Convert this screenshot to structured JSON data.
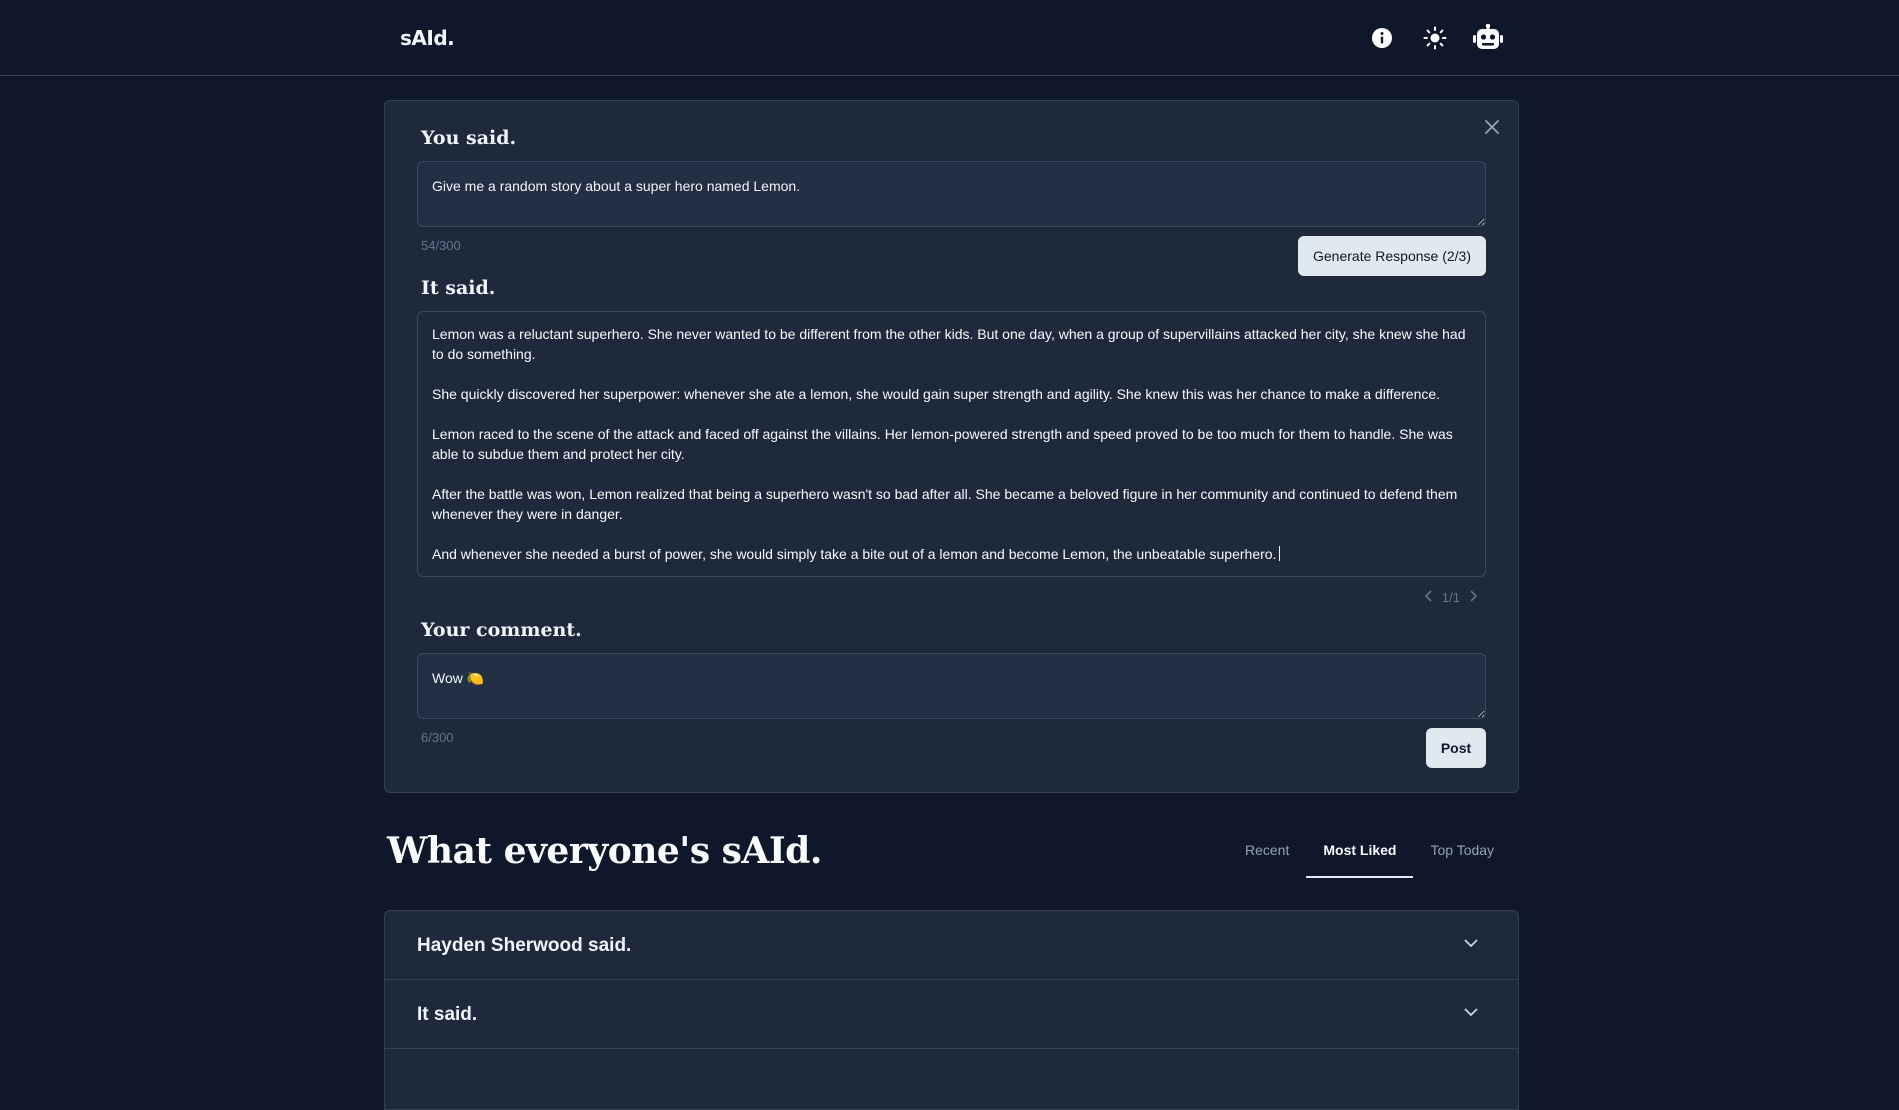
{
  "app": {
    "logo": "sAId."
  },
  "header": {
    "icons": [
      "info-icon",
      "sun-icon",
      "robot-icon"
    ]
  },
  "composer": {
    "you_said_title": "You said.",
    "prompt_value": "Give me a random story about a super hero named Lemon.",
    "prompt_counter": "54/300",
    "generate_label": "Generate Response (2/3)",
    "it_said_title": "It said.",
    "response_paragraphs": [
      "Lemon was a reluctant superhero. She never wanted to be different from the other kids. But one day, when a group of supervillains attacked her city, she knew she had to do something.",
      "She quickly discovered her superpower: whenever she ate a lemon, she would gain super strength and agility. She knew this was her chance to make a difference.",
      "Lemon raced to the scene of the attack and faced off against the villains. Her lemon-powered strength and speed proved to be too much for them to handle. She was able to subdue them and protect her city.",
      "After the battle was won, Lemon realized that being a superhero wasn't so bad after all. She became a beloved figure in her community and continued to defend them whenever they were in danger.",
      "And whenever she needed a burst of power, she would simply take a bite out of a lemon and become Lemon, the unbeatable superhero."
    ],
    "pager_text": "1/1",
    "comment_title": "Your comment.",
    "comment_value": "Wow 🍋",
    "comment_counter": "6/300",
    "post_label": "Post"
  },
  "feed": {
    "title": "What everyone's sAId.",
    "tabs": [
      {
        "label": "Recent",
        "active": false
      },
      {
        "label": "Most Liked",
        "active": true
      },
      {
        "label": "Top Today",
        "active": false
      }
    ],
    "accordion": [
      {
        "label": "Hayden Sherwood said."
      },
      {
        "label": "It said."
      }
    ]
  },
  "colors": {
    "background": "#0f172a",
    "card": "#1e293b",
    "border": "#334155",
    "button_light": "#e2e8f0"
  }
}
